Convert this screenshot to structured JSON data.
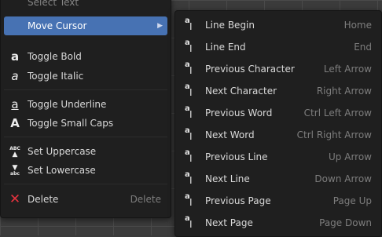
{
  "left_menu": {
    "clipped_item": "Select Text",
    "move_cursor": "Move Cursor",
    "toggle_bold": "Toggle Bold",
    "toggle_italic": "Toggle Italic",
    "toggle_underline": "Toggle Underline",
    "toggle_small_caps": "Toggle Small Caps",
    "set_uppercase": "Set Uppercase",
    "set_lowercase": "Set Lowercase",
    "delete": "Delete",
    "delete_shortcut": "Delete",
    "icons": {
      "bold": "a",
      "italic": "a",
      "underline": "a",
      "small_caps": "A",
      "uppercase_top": "ABC",
      "lowercase_bottom": "abc",
      "delete": "✕"
    },
    "accent_color": "#4772b3",
    "delete_color": "#e5323e"
  },
  "submenu": {
    "items": [
      {
        "label": "Line Begin",
        "shortcut": "Home"
      },
      {
        "label": "Line End",
        "shortcut": "End"
      },
      {
        "label": "Previous Character",
        "shortcut": "Left Arrow"
      },
      {
        "label": "Next Character",
        "shortcut": "Right Arrow"
      },
      {
        "label": "Previous Word",
        "shortcut": "Ctrl Left Arrow"
      },
      {
        "label": "Next Word",
        "shortcut": "Ctrl Right Arrow"
      },
      {
        "label": "Previous Line",
        "shortcut": "Up Arrow"
      },
      {
        "label": "Next Line",
        "shortcut": "Down Arrow"
      },
      {
        "label": "Previous Page",
        "shortcut": "Page Up"
      },
      {
        "label": "Next Page",
        "shortcut": "Page Down"
      }
    ],
    "icon_letter_a": "a",
    "icon_letter_i": "I"
  }
}
